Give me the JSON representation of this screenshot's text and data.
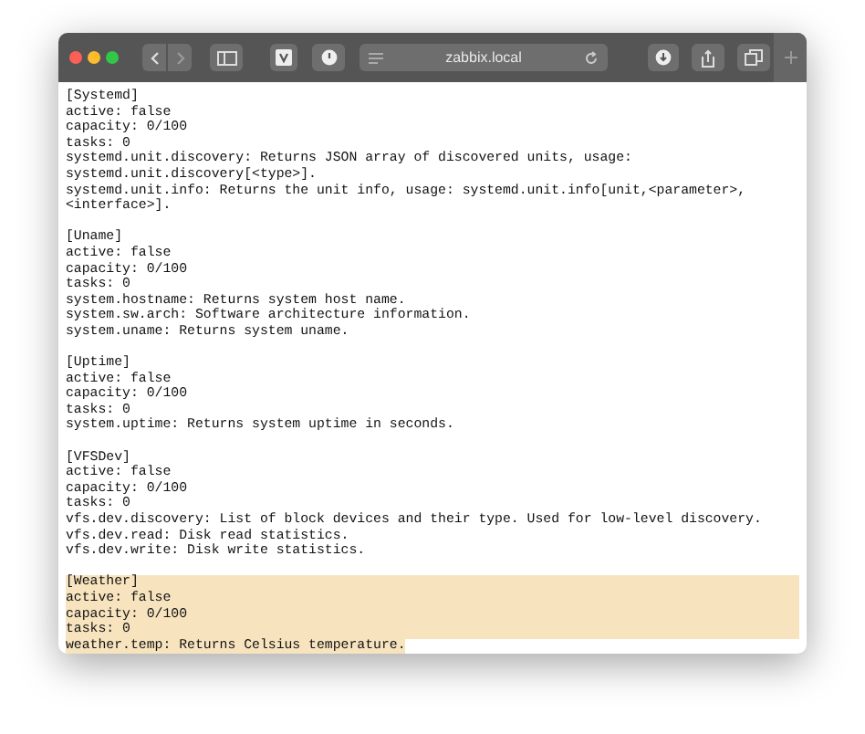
{
  "toolbar": {
    "address": "zabbix.local"
  },
  "sections": [
    {
      "header": "[Systemd]",
      "selected": false,
      "lines": [
        "active: false",
        "capacity: 0/100",
        "tasks: 0",
        "systemd.unit.discovery: Returns JSON array of discovered units, usage:",
        "systemd.unit.discovery[<type>].",
        "systemd.unit.info: Returns the unit info, usage: systemd.unit.info[unit,<parameter>,",
        "<interface>]."
      ]
    },
    {
      "header": "[Uname]",
      "selected": false,
      "lines": [
        "active: false",
        "capacity: 0/100",
        "tasks: 0",
        "system.hostname: Returns system host name.",
        "system.sw.arch: Software architecture information.",
        "system.uname: Returns system uname."
      ]
    },
    {
      "header": "[Uptime]",
      "selected": false,
      "lines": [
        "active: false",
        "capacity: 0/100",
        "tasks: 0",
        "system.uptime: Returns system uptime in seconds."
      ]
    },
    {
      "header": "[VFSDev]",
      "selected": false,
      "lines": [
        "active: false",
        "capacity: 0/100",
        "tasks: 0",
        "vfs.dev.discovery: List of block devices and their type. Used for low-level discovery.",
        "vfs.dev.read: Disk read statistics.",
        "vfs.dev.write: Disk write statistics."
      ]
    },
    {
      "header": "[Weather]",
      "selected": true,
      "lines": [
        "active: false",
        "capacity: 0/100",
        "tasks: 0",
        "weather.temp: Returns Celsius temperature."
      ]
    }
  ]
}
